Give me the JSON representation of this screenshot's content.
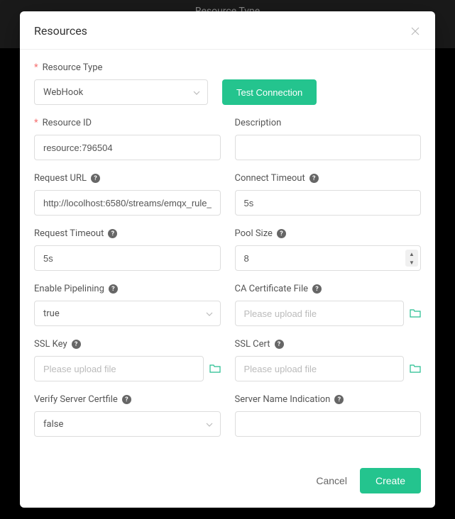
{
  "bg_title": "Resource Type",
  "modal": {
    "title": "Resources",
    "test_button": "Test Connection",
    "cancel": "Cancel",
    "create": "Create"
  },
  "fields": {
    "resource_type": {
      "label": "Resource Type",
      "value": "WebHook"
    },
    "resource_id": {
      "label": "Resource ID",
      "value": "resource:796504"
    },
    "description": {
      "label": "Description",
      "value": ""
    },
    "request_url": {
      "label": "Request URL",
      "value": "http://locolhost:6580/streams/emqx_rule_"
    },
    "connect_timeout": {
      "label": "Connect Timeout",
      "value": "5s"
    },
    "request_timeout": {
      "label": "Request Timeout",
      "value": "5s"
    },
    "pool_size": {
      "label": "Pool Size",
      "value": "8"
    },
    "enable_pipelining": {
      "label": "Enable Pipelining",
      "value": "true"
    },
    "ca_cert": {
      "label": "CA Certificate File",
      "placeholder": "Please upload file"
    },
    "ssl_key": {
      "label": "SSL Key",
      "placeholder": "Please upload file"
    },
    "ssl_cert": {
      "label": "SSL Cert",
      "placeholder": "Please upload file"
    },
    "verify_server": {
      "label": "Verify Server Certfile",
      "value": "false"
    },
    "sni": {
      "label": "Server Name Indication",
      "value": ""
    }
  }
}
